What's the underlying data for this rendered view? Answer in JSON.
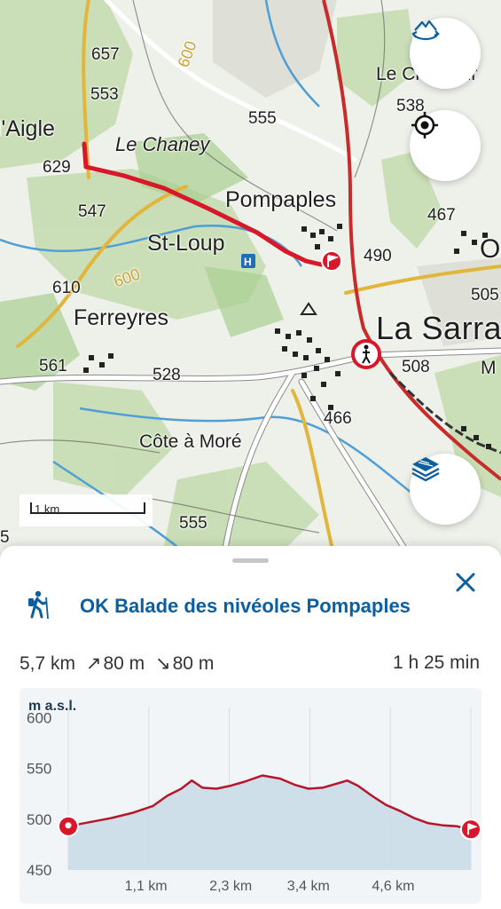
{
  "map": {
    "labels": {
      "aigle": "l'Aigle",
      "a657": "657",
      "a553": "553",
      "a629": "629",
      "chaney": "Le Chaney",
      "a555n": "555",
      "pompaples": "Pompaples",
      "a538": "538",
      "chaudiur": "Le Chaudiur",
      "a467": "467",
      "a547": "547",
      "stloup": "St-Loup",
      "a490": "490",
      "o": "O",
      "a610": "610",
      "contour600a": "600",
      "contour600b": "600",
      "a505": "505",
      "ferreyres": "Ferreyres",
      "lasarraz": "La Sarra",
      "a561": "561",
      "a528": "528",
      "a508": "508",
      "m": "M",
      "a466": "466",
      "coteamore": "Côte à Moré",
      "a555s": "555",
      "a5": "5"
    },
    "scale": "1 km"
  },
  "controls": {
    "rotate_icon": "terrain-rotate-icon",
    "locate_icon": "crosshair-icon",
    "layers_icon": "layers-icon"
  },
  "route": {
    "title": "OK Balade des nivéoles Pompaples",
    "activity_icon": "hiker-icon",
    "distance": "5,7 km",
    "ascent_symbol": "↗",
    "ascent": "80 m",
    "descent_symbol": "↘",
    "descent": "80 m",
    "duration": "1 h 25 min"
  },
  "colors": {
    "accent": "#0b5fa0",
    "route": "#d9172a",
    "profile_fill": "#c9dbe8",
    "map_road": "#ffffff",
    "map_forest": "#c8dfb6"
  },
  "chart_data": {
    "type": "area",
    "ylabel": "m a.s.l.",
    "ylim": [
      450,
      610
    ],
    "yticks": [
      450,
      500,
      550,
      600
    ],
    "xlim": [
      0,
      5.7
    ],
    "xtick_labels": [
      "1,1 km",
      "2,3 km",
      "3,4 km",
      "4,6 km"
    ],
    "xtick_values": [
      1.1,
      2.3,
      3.4,
      4.6
    ],
    "series": [
      {
        "x": [
          0,
          0.3,
          0.6,
          0.9,
          1.2,
          1.4,
          1.6,
          1.75,
          1.9,
          2.1,
          2.3,
          2.5,
          2.75,
          3.0,
          3.2,
          3.4,
          3.6,
          3.8,
          3.95,
          4.1,
          4.3,
          4.5,
          4.7,
          4.9,
          5.1,
          5.3,
          5.5,
          5.7
        ],
        "y": [
          493,
          497,
          501,
          506,
          513,
          523,
          530,
          538,
          531,
          530,
          533,
          537,
          543,
          540,
          534,
          530,
          531,
          535,
          538,
          533,
          523,
          514,
          508,
          501,
          496,
          494,
          493,
          490
        ]
      }
    ],
    "grid": "vertical",
    "start_marker": "location-pin-icon",
    "end_marker": "flag-icon"
  }
}
